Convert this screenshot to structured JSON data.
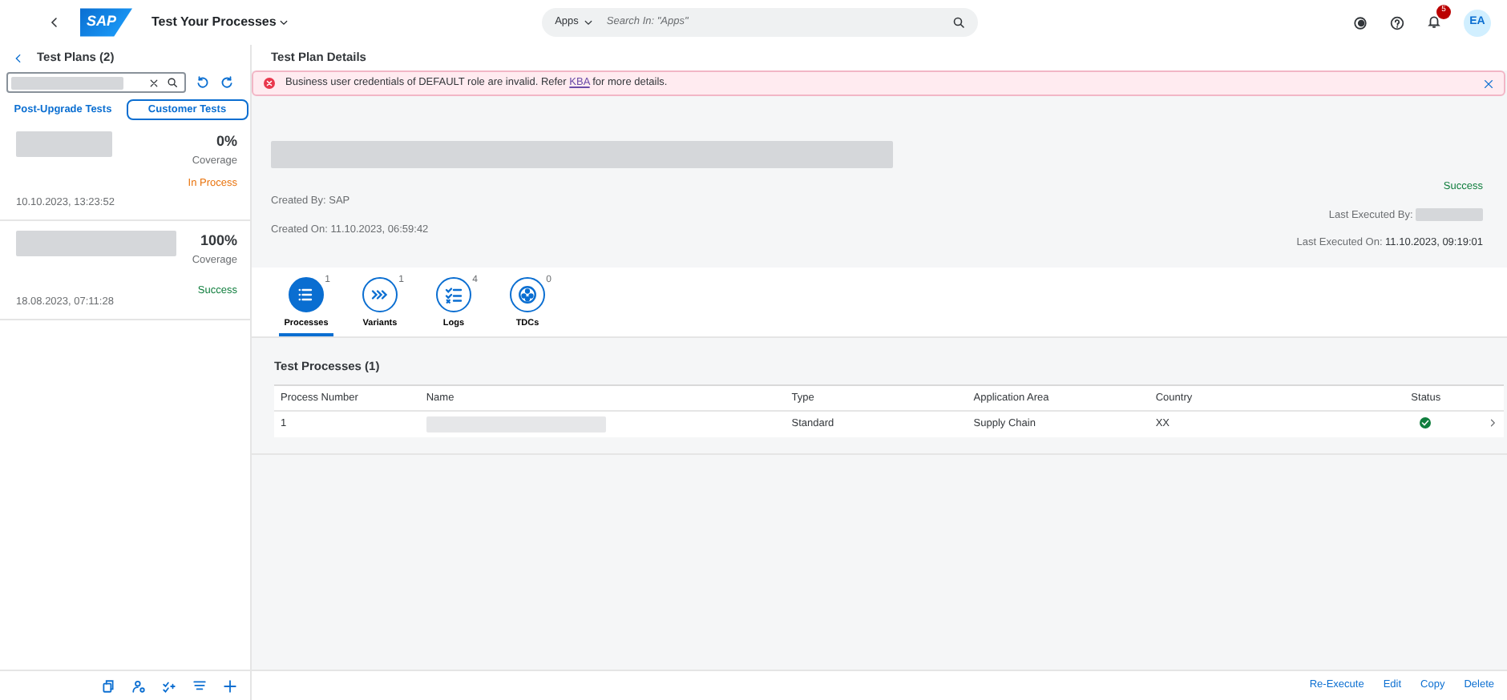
{
  "shell": {
    "logo": "SAP",
    "title": "Test Your Processes",
    "search_scope": "Apps",
    "search_placeholder": "Search In: \"Apps\"",
    "notification_count": "5",
    "avatar": "EA"
  },
  "master": {
    "title": "Test Plans (2)",
    "segments": [
      {
        "label": "Post-Upgrade Tests",
        "selected": false
      },
      {
        "label": "Customer Tests",
        "selected": true
      }
    ],
    "plans": [
      {
        "coverage": "0%",
        "coverage_label": "Coverage",
        "status": "In Process",
        "kind": "warning",
        "date": "10.10.2023, 13:23:52",
        "selected": false
      },
      {
        "coverage": "100%",
        "coverage_label": "Coverage",
        "status": "Success",
        "kind": "success",
        "date": "18.08.2023, 07:11:28",
        "selected": false
      }
    ]
  },
  "detail": {
    "title": "Test Plan Details",
    "message": {
      "before": "Business user credentials of DEFAULT role are invalid. Refer ",
      "link": "KBA",
      "after": " for more details."
    },
    "created_by": "Created By: SAP",
    "created_on": "Created On: 11.10.2023, 06:59:42",
    "status": "Success",
    "last_executed_by_label": "Last Executed By:",
    "last_executed_on_label": "Last Executed On:",
    "last_executed_on": "11.10.2023, 09:19:01",
    "tabs": [
      {
        "label": "Processes",
        "count": "1",
        "kind": "list",
        "selected": true
      },
      {
        "label": "Variants",
        "count": "1",
        "kind": "chevrons",
        "selected": false
      },
      {
        "label": "Logs",
        "count": "4",
        "kind": "checklist",
        "selected": false
      },
      {
        "label": "TDCs",
        "count": "0",
        "kind": "cluster",
        "selected": false
      }
    ],
    "table": {
      "title": "Test Processes (1)",
      "columns": [
        "Process Number",
        "Name",
        "Type",
        "Application Area",
        "Country",
        "Status"
      ],
      "rows": [
        {
          "process_number": "1",
          "type": "Standard",
          "application_area": "Supply Chain",
          "country": "XX",
          "kind": "success"
        }
      ]
    },
    "footer_buttons": [
      "Re-Execute",
      "Edit",
      "Copy",
      "Delete"
    ]
  }
}
